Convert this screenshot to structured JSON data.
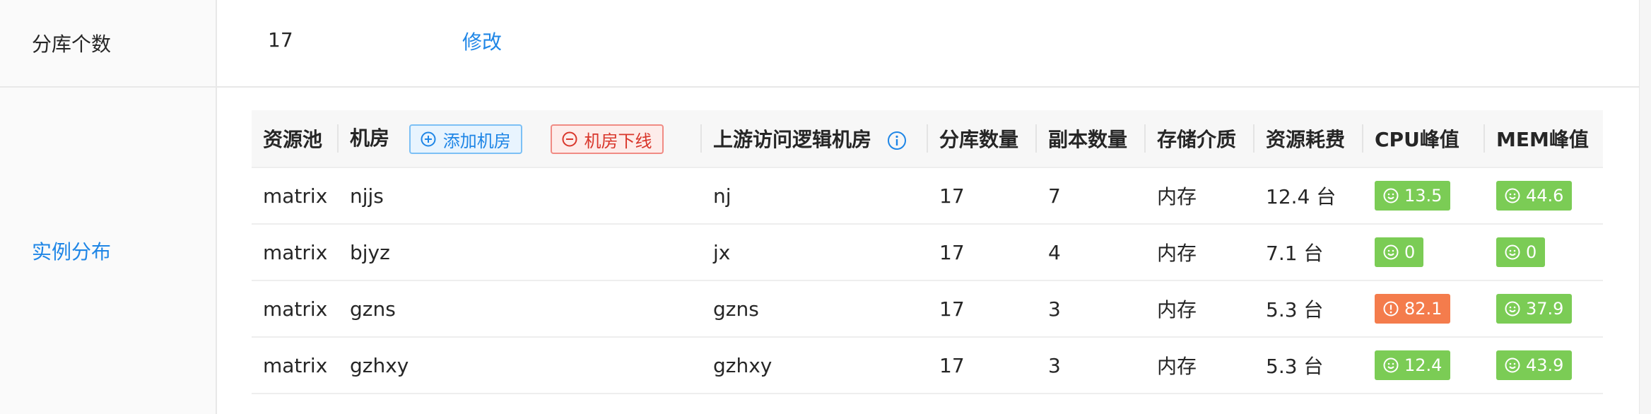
{
  "shard_row": {
    "label": "分库个数",
    "value": "17",
    "modify_label": "修改"
  },
  "instance_row": {
    "label": "实例分布"
  },
  "table": {
    "headers": {
      "pool": "资源池",
      "room": "机房",
      "add_room": "添加机房",
      "room_offline": "机房下线",
      "upstream": "上游访问逻辑机房",
      "shards": "分库数量",
      "replicas": "副本数量",
      "storage": "存储介质",
      "cost": "资源耗费",
      "cpu": "CPU峰值",
      "mem": "MEM峰值"
    },
    "rows": [
      {
        "pool": "matrix",
        "room": "njjs",
        "upstream": "nj",
        "shards": "17",
        "replicas": "7",
        "storage": "内存",
        "cost": "12.4 台",
        "cpu": "13.5",
        "cpu_status": "ok",
        "mem": "44.6",
        "mem_status": "ok"
      },
      {
        "pool": "matrix",
        "room": "bjyz",
        "upstream": "jx",
        "shards": "17",
        "replicas": "4",
        "storage": "内存",
        "cost": "7.1 台",
        "cpu": "0",
        "cpu_status": "ok",
        "mem": "0",
        "mem_status": "ok"
      },
      {
        "pool": "matrix",
        "room": "gzns",
        "upstream": "gzns",
        "shards": "17",
        "replicas": "3",
        "storage": "内存",
        "cost": "5.3 台",
        "cpu": "82.1",
        "cpu_status": "warning",
        "mem": "37.9",
        "mem_status": "ok"
      },
      {
        "pool": "matrix",
        "room": "gzhxy",
        "upstream": "gzhxy",
        "shards": "17",
        "replicas": "3",
        "storage": "内存",
        "cost": "5.3 台",
        "cpu": "12.4",
        "cpu_status": "ok",
        "mem": "43.9",
        "mem_status": "ok"
      }
    ]
  },
  "colors": {
    "link": "#1f86e6",
    "ok_badge": "#7bcc55",
    "warning_badge": "#f47c4c",
    "danger": "#d9362b"
  },
  "icons": {
    "add": "plus-circle-icon",
    "offline": "minus-circle-icon",
    "info": "info-circle-icon",
    "ok": "smile-icon",
    "warning": "exclamation-circle-icon"
  }
}
